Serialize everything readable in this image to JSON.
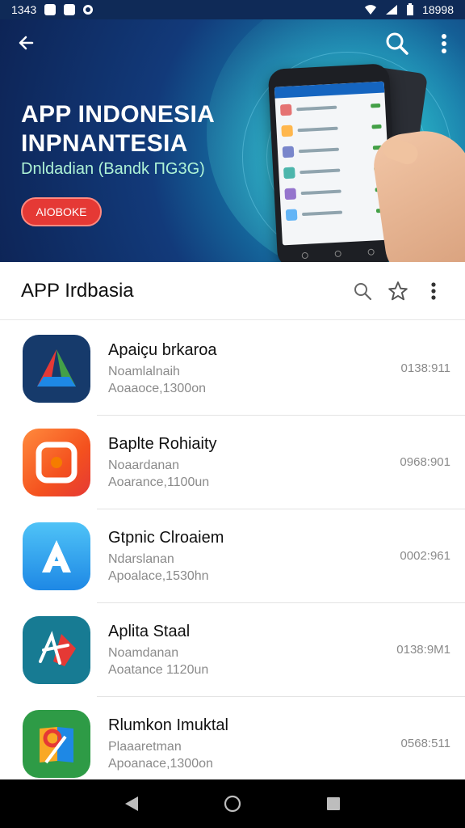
{
  "status_bar": {
    "time": "1343",
    "battery": "18998"
  },
  "hero": {
    "title_line1": "APP INDONESIA",
    "title_line2": "INPNANTESIA",
    "subtitle": "Dnldadian (Bandk ПG3G)",
    "button_label": "AIOBOKE"
  },
  "header": {
    "title": "APP Irdbasia"
  },
  "apps": [
    {
      "name": "Apaiçu brkaroa",
      "line1": "Noamlalnaih",
      "line2": "Aoaaoce,1300on",
      "time": "0138:911"
    },
    {
      "name": "Baplte Rohiaity",
      "line1": "Noaardanan",
      "line2": "Aoarance,1100un",
      "time": "0968:901"
    },
    {
      "name": "Gtpnic Clroaiem",
      "line1": "Ndarslanan",
      "line2": "Apoalace,1530hn",
      "time": "0002:961"
    },
    {
      "name": "Aplita Staal",
      "line1": "Noamdanan",
      "line2": "Aoatance 1120un",
      "time": "0138:9M1"
    },
    {
      "name": "Rlumkon Imuktal",
      "line1": "Plaaaretman",
      "line2": "Apoanace,1300on",
      "time": "0568:511"
    }
  ],
  "colors": {
    "status_bar": "#0f2a57",
    "cta": "#e53935",
    "subtitle": "#aef3d6"
  }
}
